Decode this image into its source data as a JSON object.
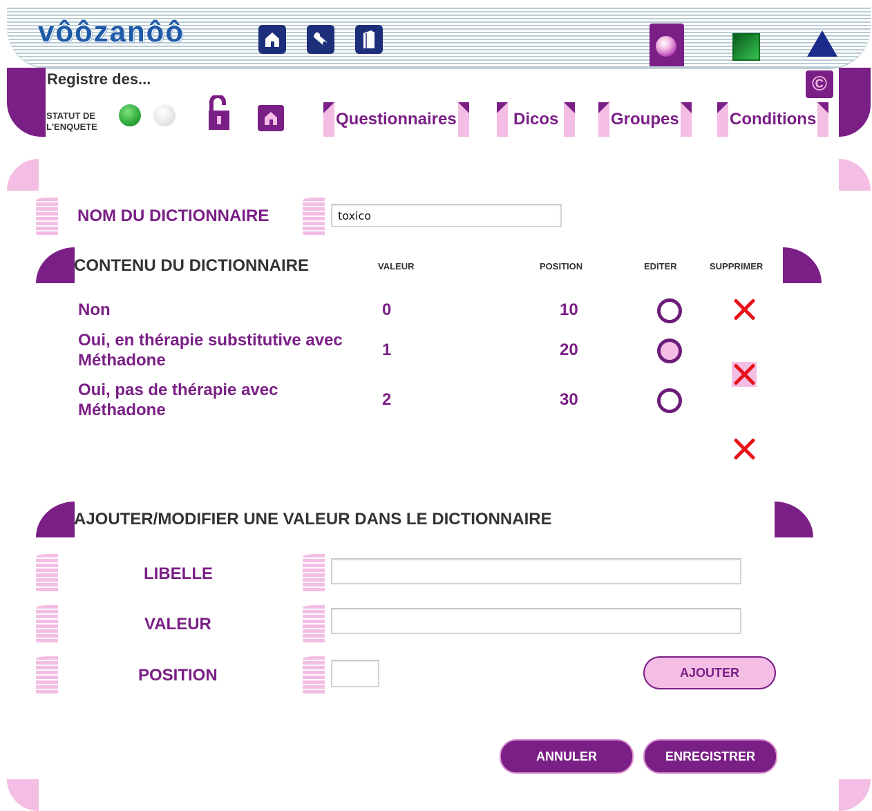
{
  "header": {
    "logo_text": "vôôzanôô",
    "icons": [
      "home-icon",
      "tools-icon",
      "book-icon",
      "purple-ball-icon",
      "green-square-icon",
      "blue-triangle-icon"
    ]
  },
  "registre": {
    "title": "Registre des..."
  },
  "status": {
    "label_line1": "STATUT DE",
    "label_line2": "L'ENQUETE"
  },
  "nav": {
    "tabs": [
      {
        "label": "Questionnaires"
      },
      {
        "label": "Dicos"
      },
      {
        "label": "Groupes"
      },
      {
        "label": "Conditions"
      }
    ]
  },
  "dictionary": {
    "name_label": "NOM DU DICTIONNAIRE",
    "name_value": "toxico"
  },
  "content": {
    "title": "CONTENU DU DICTIONNAIRE",
    "columns": {
      "valeur": "VALEUR",
      "position": "POSITION",
      "editer": "EDITER",
      "supprimer": "SUPPRIMER"
    },
    "rows": [
      {
        "line1": "Non",
        "line2": "",
        "valeur": "0",
        "position": "10"
      },
      {
        "line1": "Oui, en thérapie substitutive avec",
        "line2": "Méthadone",
        "valeur": "1",
        "position": "20"
      },
      {
        "line1": "Oui, pas de thérapie avec",
        "line2": "Méthadone",
        "valeur": "2",
        "position": "30"
      }
    ]
  },
  "form": {
    "title": "AJOUTER/MODIFIER UNE VALEUR DANS LE DICTIONNAIRE",
    "libelle_label": "LIBELLE",
    "libelle_value": "",
    "valeur_label": "VALEUR",
    "valeur_value": "",
    "position_label": "POSITION",
    "position_value": "",
    "ajouter": "AJOUTER"
  },
  "actions": {
    "annuler": "ANNULER",
    "enregistrer": "ENREGISTRER"
  },
  "colors": {
    "brand_purple": "#7a1f86",
    "pink": "#f4bde4",
    "delete_red": "#e8121a",
    "nav_blue": "#1d2f7a"
  }
}
